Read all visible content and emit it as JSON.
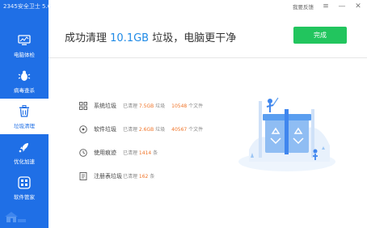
{
  "app": {
    "title": "2345安全卫士 5.6"
  },
  "topbar": {
    "feedback_label": "我要反馈"
  },
  "sidebar": {
    "items": [
      {
        "label": "电脑体检",
        "icon": "monitor-icon",
        "active": false
      },
      {
        "label": "病毒查杀",
        "icon": "shield-bug-icon",
        "active": false
      },
      {
        "label": "垃圾清理",
        "icon": "trash-icon",
        "active": true
      },
      {
        "label": "优化加速",
        "icon": "rocket-icon",
        "active": false
      },
      {
        "label": "软件管家",
        "icon": "apps-icon",
        "active": false
      }
    ]
  },
  "header": {
    "prefix": "成功清理 ",
    "size": "10.1GB",
    "suffix": " 垃圾，电脑更干净",
    "done_label": "完成"
  },
  "results": [
    {
      "name": "系统垃圾",
      "icon": "grid-icon",
      "size_prefix": "已清理 ",
      "size": "7.5GB",
      "size_suffix": " 垃圾",
      "count": "10548",
      "count_suffix": " 个文件"
    },
    {
      "name": "软件垃圾",
      "icon": "disc-icon",
      "size_prefix": "已清理 ",
      "size": "2.6GB",
      "size_suffix": " 垃圾",
      "count": "40567",
      "count_suffix": " 个文件"
    },
    {
      "name": "使用痕迹",
      "icon": "clock-icon",
      "size_prefix": "已清理 ",
      "size": "1414",
      "size_suffix": " 条",
      "count": "",
      "count_suffix": ""
    },
    {
      "name": "注册表垃圾",
      "icon": "document-icon",
      "size_prefix": "已清理 ",
      "size": "162",
      "size_suffix": " 条",
      "count": "",
      "count_suffix": ""
    }
  ],
  "colors": {
    "sidebar": "#1f6fe6",
    "accent": "#1f8ae6",
    "done_button": "#22c55e",
    "highlight_number": "#f07326"
  }
}
